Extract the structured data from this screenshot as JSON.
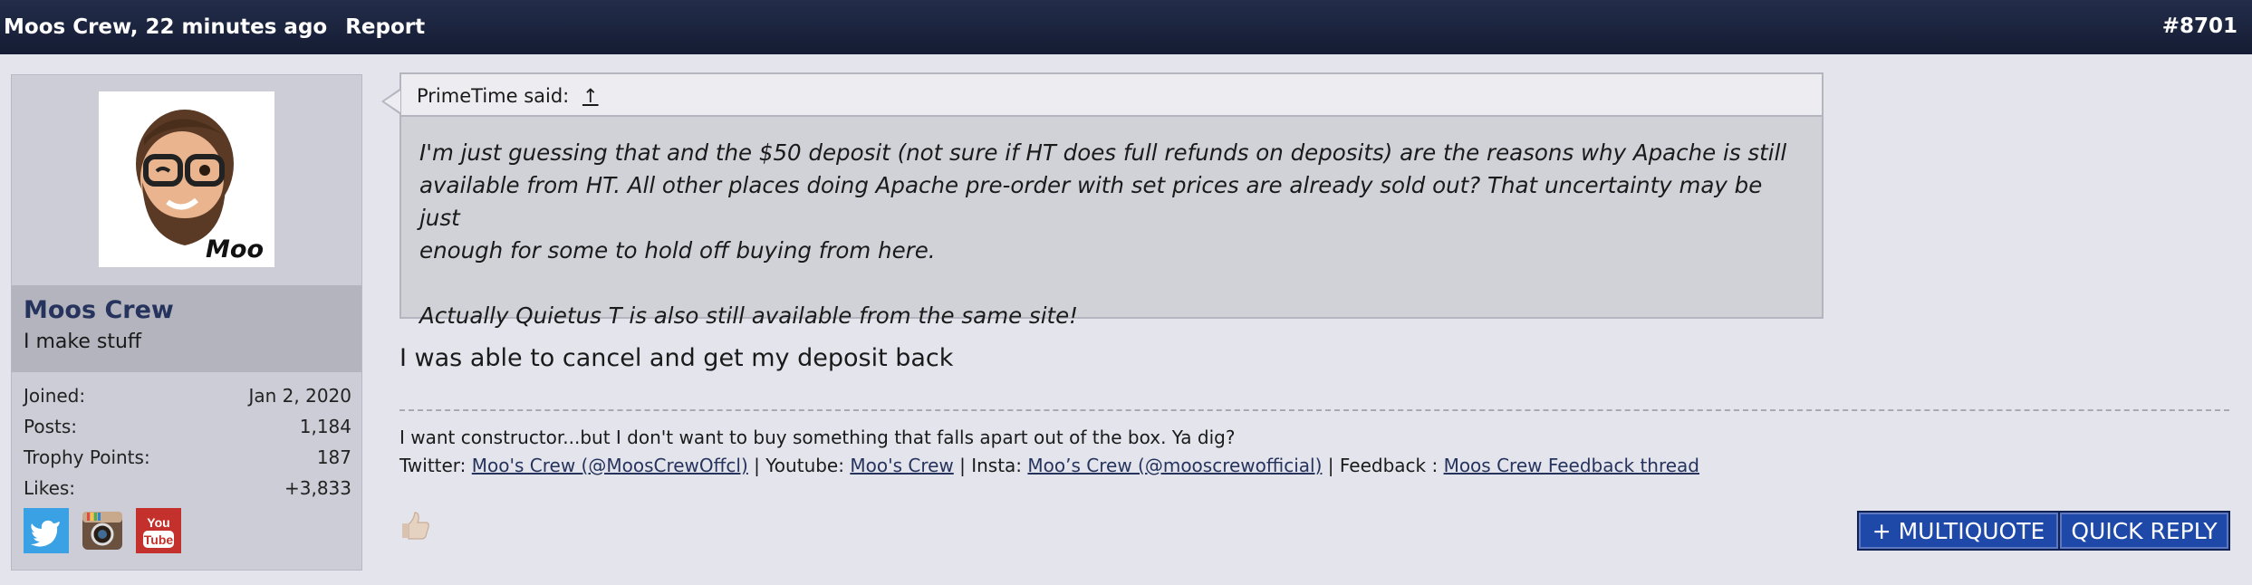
{
  "header": {
    "author_time": "Moos Crew, 22 minutes ago",
    "report_label": "Report",
    "post_number": "#8701"
  },
  "sidebar": {
    "avatar_text": "Moo",
    "username": "Moos Crew",
    "user_title": "I make stuff",
    "stats": [
      {
        "label": "Joined:",
        "value": "Jan 2, 2020"
      },
      {
        "label": "Posts:",
        "value": "1,184"
      },
      {
        "label": "Trophy Points:",
        "value": "187"
      },
      {
        "label": "Likes:",
        "value": "+3,833"
      }
    ],
    "social_icons": [
      "twitter-icon",
      "instagram-icon",
      "youtube-icon"
    ]
  },
  "quote": {
    "author": "PrimeTime said:",
    "arrow": "↑",
    "text": "I'm just guessing that and the $50 deposit (not sure if HT does full refunds on deposits) are the reasons why Apache is still\navailable from HT. All other places doing Apache pre-order with set prices are already sold out? That uncertainty may be just\nenough for some to hold off buying from here.\n\nActually Quietus T is also still available from the same site!"
  },
  "message": "I was able to cancel and get my deposit back",
  "signature": {
    "line1": "I want constructor...but I don't want to buy something that falls apart out of the box. Ya dig?",
    "twitter_label": "Twitter: ",
    "twitter_link": "Moo's Crew (@MoosCrewOffcl)",
    "sep1": " | Youtube: ",
    "youtube_link": "Moo's Crew",
    "sep2": " | Insta: ",
    "insta_link": "Moo’s Crew (@mooscrewofficial)",
    "sep3": " | Feedback : ",
    "feedback_link": "Moos Crew Feedback thread"
  },
  "actions": {
    "multiquote": "+ MULTIQUOTE",
    "quick_reply": "QUICK REPLY"
  },
  "colors": {
    "header_bg": "#1b2440",
    "username": "#26345d",
    "button_bg": "#1e49a8",
    "twitter": "#3aa1e4",
    "youtube": "#c4302b"
  }
}
